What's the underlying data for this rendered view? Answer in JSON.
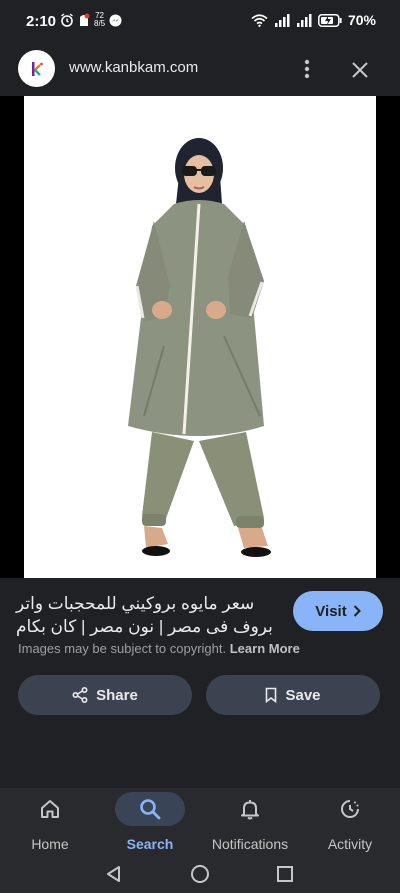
{
  "status": {
    "time": "2:10",
    "notif_count_top": "72",
    "notif_count_bottom": "8/5",
    "battery": "70%"
  },
  "header": {
    "site_url": "www.kanbkam.com",
    "site_logo_letter": "k"
  },
  "result": {
    "title_line1": "سعر مايوه بروكيني للمحجبات واتر",
    "title_line2": "بروف فى مصر | نون مصر | كان بكام",
    "visit_label": "Visit",
    "copyright_text": "Images may be subject to copyright.",
    "learn_more": "Learn More",
    "share_label": "Share",
    "save_label": "Save"
  },
  "bottom_nav": {
    "items": [
      {
        "label": "Home",
        "icon": "home-icon"
      },
      {
        "label": "Search",
        "icon": "search-icon",
        "active": true
      },
      {
        "label": "Notifications",
        "icon": "bell-icon"
      },
      {
        "label": "Activity",
        "icon": "activity-icon"
      }
    ]
  },
  "colors": {
    "background": "#202124",
    "accent": "#8ab4f8",
    "button": "#3c4350",
    "nav": "#282a2d"
  }
}
